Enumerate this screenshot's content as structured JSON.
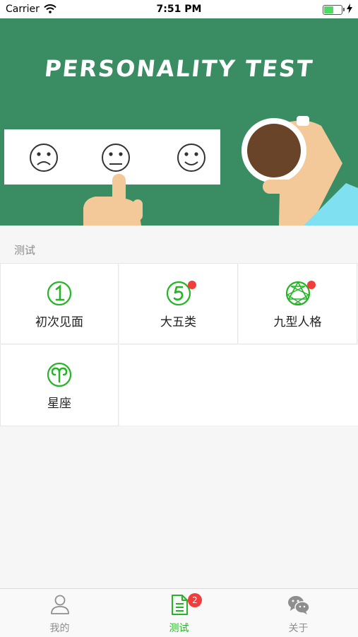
{
  "status_bar": {
    "carrier": "Carrier",
    "time": "7:51 PM"
  },
  "banner": {
    "title": "PERSONALITY TEST"
  },
  "section": {
    "title": "测试"
  },
  "tests": [
    {
      "label": "初次见面",
      "icon": "number-one-circle-icon",
      "has_dot": false
    },
    {
      "label": "大五类",
      "icon": "number-five-circle-icon",
      "has_dot": true
    },
    {
      "label": "九型人格",
      "icon": "enneagram-icon",
      "has_dot": true
    },
    {
      "label": "星座",
      "icon": "aries-zodiac-icon",
      "has_dot": false
    }
  ],
  "tab_bar": {
    "tabs": [
      {
        "label": "我的",
        "icon": "person-icon",
        "active": false
      },
      {
        "label": "测试",
        "icon": "document-icon",
        "active": true,
        "badge": "2"
      },
      {
        "label": "关于",
        "icon": "wechat-chat-icon",
        "active": false
      }
    ]
  },
  "colors": {
    "accent_green": "#24b524",
    "banner_green": "#3a8c62",
    "badge_red": "#f23d3d"
  }
}
